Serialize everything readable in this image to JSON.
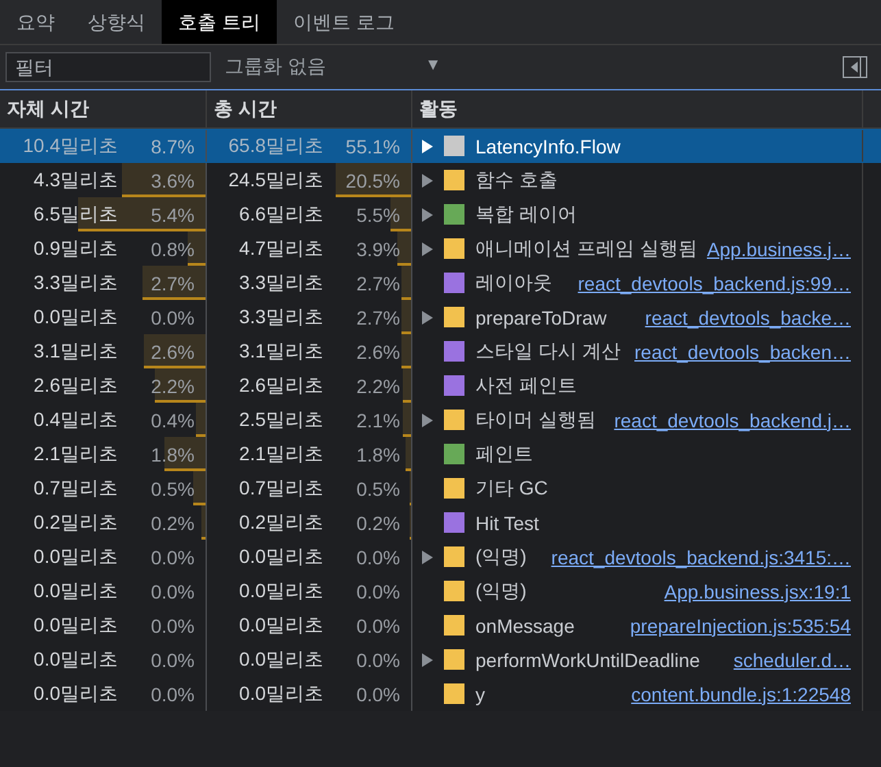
{
  "tabs": [
    {
      "label": "요약",
      "selected": false
    },
    {
      "label": "상향식",
      "selected": false
    },
    {
      "label": "호출 트리",
      "selected": true
    },
    {
      "label": "이벤트 로그",
      "selected": false
    }
  ],
  "toolbar": {
    "filter": {
      "placeholder": "필터"
    },
    "grouping": {
      "value": "그룹화 없음",
      "arrow": "▼"
    }
  },
  "table": {
    "columns": [
      "자체 시간",
      "총 시간",
      "활동"
    ],
    "rows": [
      {
        "self": {
          "time": "10.4밀리초",
          "percent": "8.7%"
        },
        "total": {
          "time": "65.8밀리초",
          "percent": "55.1%"
        },
        "expandable": true,
        "color": "#c8c8c8",
        "name": "LatencyInfo.Flow",
        "selected": true
      },
      {
        "self": {
          "time": "4.3밀리초",
          "percent": "3.6%",
          "level": 0.41
        },
        "total": {
          "time": "24.5밀리초",
          "percent": "20.5%",
          "level": 0.37
        },
        "expandable": true,
        "color": "#f2c14e",
        "name": "함수 호출",
        "selected": false
      },
      {
        "self": {
          "time": "6.5밀리초",
          "percent": "5.4%",
          "level": 0.62
        },
        "total": {
          "time": "6.6밀리초",
          "percent": "5.5%",
          "level": 0.1
        },
        "expandable": true,
        "color": "#67a957",
        "name": "복합 레이어",
        "selected": false
      },
      {
        "self": {
          "time": "0.9밀리초",
          "percent": "0.8%",
          "level": 0.09
        },
        "total": {
          "time": "4.7밀리초",
          "percent": "3.9%",
          "level": 0.07
        },
        "expandable": true,
        "color": "#f2c14e",
        "name": "애니메이션 프레임 실행됨",
        "link": "App.business.j…",
        "selected": false
      },
      {
        "self": {
          "time": "3.3밀리초",
          "percent": "2.7%",
          "level": 0.31
        },
        "total": {
          "time": "3.3밀리초",
          "percent": "2.7%",
          "level": 0.05
        },
        "expandable": false,
        "color": "#9a72e0",
        "name": "레이아웃",
        "link": "react_devtools_backend.js:99…",
        "selected": false
      },
      {
        "self": {
          "time": "0.0밀리초",
          "percent": "0.0%"
        },
        "total": {
          "time": "3.3밀리초",
          "percent": "2.7%",
          "level": 0.05
        },
        "expandable": true,
        "color": "#f2c14e",
        "name": "prepareToDraw",
        "link": "react_devtools_backe…",
        "selected": false
      },
      {
        "self": {
          "time": "3.1밀리초",
          "percent": "2.6%",
          "level": 0.3
        },
        "total": {
          "time": "3.1밀리초",
          "percent": "2.6%",
          "level": 0.05
        },
        "expandable": false,
        "color": "#9a72e0",
        "name": "스타일 다시 계산",
        "link": "react_devtools_backen…",
        "selected": false
      },
      {
        "self": {
          "time": "2.6밀리초",
          "percent": "2.2%",
          "level": 0.25
        },
        "total": {
          "time": "2.6밀리초",
          "percent": "2.2%",
          "level": 0.04
        },
        "expandable": false,
        "color": "#9a72e0",
        "name": "사전 페인트",
        "selected": false
      },
      {
        "self": {
          "time": "0.4밀리초",
          "percent": "0.4%",
          "level": 0.05
        },
        "total": {
          "time": "2.5밀리초",
          "percent": "2.1%",
          "level": 0.04
        },
        "expandable": true,
        "color": "#f2c14e",
        "name": "타이머 실행됨",
        "link": "react_devtools_backend.j…",
        "selected": false
      },
      {
        "self": {
          "time": "2.1밀리초",
          "percent": "1.8%",
          "level": 0.2
        },
        "total": {
          "time": "2.1밀리초",
          "percent": "1.8%",
          "level": 0.03
        },
        "expandable": false,
        "color": "#67a957",
        "name": "페인트",
        "selected": false
      },
      {
        "self": {
          "time": "0.7밀리초",
          "percent": "0.5%",
          "level": 0.06
        },
        "total": {
          "time": "0.7밀리초",
          "percent": "0.5%",
          "level": 0.01
        },
        "expandable": false,
        "color": "#f2c14e",
        "name": "기타 GC",
        "selected": false
      },
      {
        "self": {
          "time": "0.2밀리초",
          "percent": "0.2%",
          "level": 0.02
        },
        "total": {
          "time": "0.2밀리초",
          "percent": "0.2%",
          "level": 0.004
        },
        "expandable": false,
        "color": "#9a72e0",
        "name": "Hit Test",
        "selected": false
      },
      {
        "self": {
          "time": "0.0밀리초",
          "percent": "0.0%"
        },
        "total": {
          "time": "0.0밀리초",
          "percent": "0.0%"
        },
        "expandable": true,
        "color": "#f2c14e",
        "name": "(익명)",
        "link": "react_devtools_backend.js:3415:…",
        "selected": false
      },
      {
        "self": {
          "time": "0.0밀리초",
          "percent": "0.0%"
        },
        "total": {
          "time": "0.0밀리초",
          "percent": "0.0%"
        },
        "expandable": false,
        "color": "#f2c14e",
        "name": "(익명)",
        "link": "App.business.jsx:19:1",
        "selected": false
      },
      {
        "self": {
          "time": "0.0밀리초",
          "percent": "0.0%"
        },
        "total": {
          "time": "0.0밀리초",
          "percent": "0.0%"
        },
        "expandable": false,
        "color": "#f2c14e",
        "name": "onMessage",
        "link": "prepareInjection.js:535:54",
        "selected": false
      },
      {
        "self": {
          "time": "0.0밀리초",
          "percent": "0.0%"
        },
        "total": {
          "time": "0.0밀리초",
          "percent": "0.0%"
        },
        "expandable": true,
        "color": "#f2c14e",
        "name": "performWorkUntilDeadline",
        "link": "scheduler.d…",
        "selected": false
      },
      {
        "self": {
          "time": "0.0밀리초",
          "percent": "0.0%"
        },
        "total": {
          "time": "0.0밀리초",
          "percent": "0.0%"
        },
        "expandable": false,
        "color": "#f2c14e",
        "name": "y",
        "link": "content.bundle.js:1:22548",
        "selected": false
      }
    ]
  }
}
